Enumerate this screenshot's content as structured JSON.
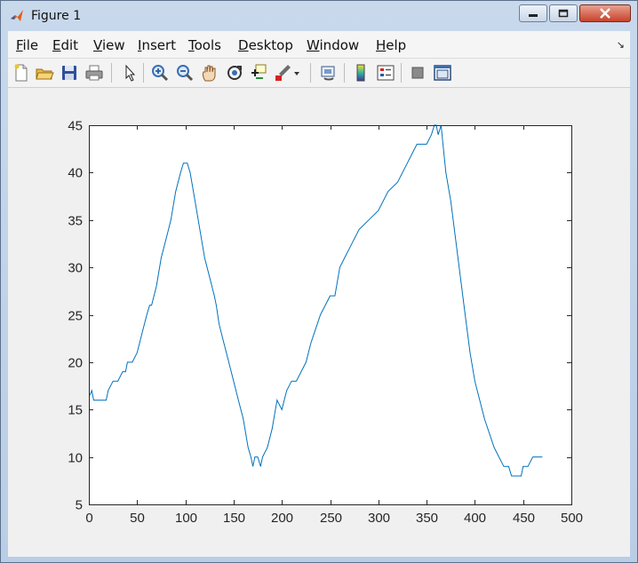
{
  "window": {
    "title": "Figure 1"
  },
  "menu": {
    "items": [
      {
        "acc": "F",
        "rest": "ile"
      },
      {
        "acc": "E",
        "rest": "dit"
      },
      {
        "acc": "V",
        "rest": "iew"
      },
      {
        "acc": "I",
        "rest": "nsert"
      },
      {
        "acc": "T",
        "rest": "ools"
      },
      {
        "acc": "D",
        "rest": "esktop"
      },
      {
        "acc": "W",
        "rest": "indow"
      },
      {
        "acc": "H",
        "rest": "elp"
      }
    ],
    "overflow_icon": "dock-arrow-icon"
  },
  "toolbar": {
    "icons": [
      "new-figure-icon",
      "open-file-icon",
      "save-icon",
      "print-icon",
      "pointer-icon",
      "zoom-in-icon",
      "zoom-out-icon",
      "pan-icon",
      "rotate-3d-icon",
      "data-cursor-icon",
      "brush-icon",
      "link-plot-icon",
      "colorbar-icon",
      "legend-icon",
      "hide-plot-tools-icon",
      "show-plot-tools-icon"
    ]
  },
  "colors": {
    "line": "#0072bd",
    "axes_bg": "#ffffff",
    "figure_bg": "#f0f0f0"
  },
  "chart_data": {
    "type": "line",
    "title": "",
    "xlabel": "",
    "ylabel": "",
    "xlim": [
      0,
      500
    ],
    "ylim": [
      5,
      45
    ],
    "xticks": [
      0,
      50,
      100,
      150,
      200,
      250,
      300,
      350,
      400,
      450,
      500
    ],
    "yticks": [
      5,
      10,
      15,
      20,
      25,
      30,
      35,
      40,
      45
    ],
    "grid": false,
    "series": [
      {
        "x": [
          1,
          3,
          5,
          10,
          15,
          18,
          20,
          25,
          30,
          35,
          38,
          40,
          45,
          50,
          55,
          60,
          63,
          65,
          70,
          75,
          80,
          85,
          90,
          95,
          98,
          100,
          102,
          105,
          110,
          115,
          120,
          125,
          130,
          132,
          135,
          140,
          145,
          150,
          155,
          160,
          165,
          168,
          170,
          172,
          175,
          178,
          180,
          185,
          190,
          195,
          200,
          205,
          210,
          215,
          220,
          225,
          230,
          240,
          250,
          255,
          260,
          265,
          270,
          280,
          290,
          300,
          310,
          320,
          330,
          335,
          340,
          345,
          350,
          355,
          358,
          360,
          362,
          365,
          368,
          370,
          375,
          380,
          385,
          390,
          395,
          400,
          410,
          420,
          425,
          430,
          435,
          438,
          440,
          442,
          445,
          448,
          450,
          455,
          460,
          465,
          470
        ],
        "y": [
          16.5,
          17,
          16,
          16,
          16,
          16,
          17,
          18,
          18,
          19,
          19,
          20,
          20,
          21,
          23,
          25,
          26,
          26,
          28,
          31,
          33,
          35,
          38,
          40,
          41,
          41,
          41,
          40,
          37,
          34,
          31,
          29,
          27,
          26,
          24,
          22,
          20,
          18,
          16,
          14,
          11,
          10,
          9,
          10,
          10,
          9,
          10,
          11,
          13,
          16,
          15,
          17,
          18,
          18,
          19,
          20,
          22,
          25,
          27,
          27,
          30,
          31,
          32,
          34,
          35,
          36,
          38,
          39,
          41,
          42,
          43,
          43,
          43,
          44,
          45,
          45,
          44,
          45,
          42,
          40,
          37,
          33,
          29,
          25,
          21,
          18,
          14,
          11,
          10,
          9,
          9,
          8,
          8,
          8,
          8,
          8,
          9,
          9,
          10,
          10,
          10
        ]
      }
    ]
  }
}
